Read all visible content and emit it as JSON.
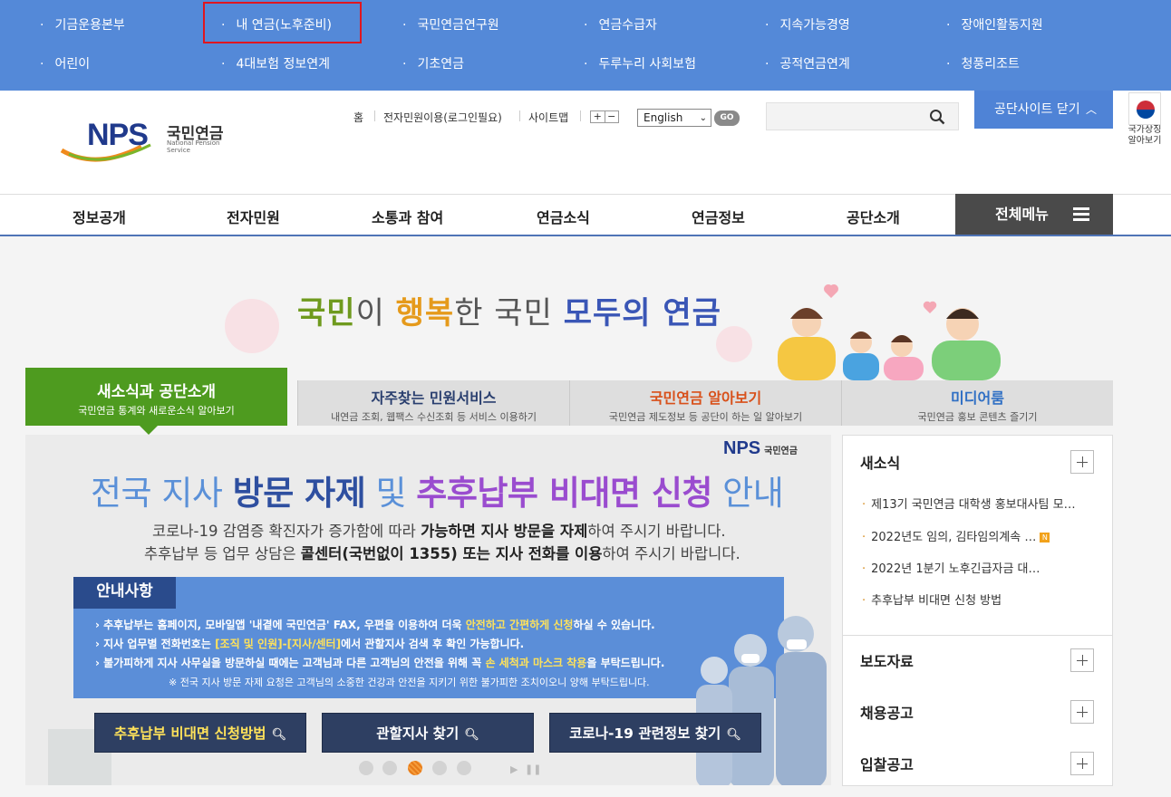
{
  "top_links": [
    {
      "label": "기금운용본부"
    },
    {
      "label": "내 연금(노후준비)"
    },
    {
      "label": "국민연금연구원"
    },
    {
      "label": "연금수급자"
    },
    {
      "label": "지속가능경영"
    },
    {
      "label": "장애인활동지원"
    },
    {
      "label": "어린이"
    },
    {
      "label": "4대보험 정보연계"
    },
    {
      "label": "기초연금"
    },
    {
      "label": "두루누리 사회보험"
    },
    {
      "label": "공적연금연계"
    },
    {
      "label": "청풍리조트"
    }
  ],
  "logo": {
    "mark": "NPS",
    "name": "국민연금",
    "english": "National Pension Service"
  },
  "util": {
    "home": "홈",
    "e_civil": "전자민원이용(로그인필요)",
    "sitemap": "사이트맵",
    "zoom_in": "+",
    "zoom_out": "−",
    "language": "English",
    "go": "GO"
  },
  "search": {
    "placeholder": ""
  },
  "close_site": "공단사이트 닫기",
  "national_symbol": {
    "line1": "국가상징",
    "line2": "알아보기"
  },
  "gnb": [
    {
      "label": "정보공개"
    },
    {
      "label": "전자민원"
    },
    {
      "label": "소통과 참여"
    },
    {
      "label": "연금소식"
    },
    {
      "label": "연금정보"
    },
    {
      "label": "공단소개"
    }
  ],
  "all_menu": "전체메뉴",
  "slogan": {
    "p1": "국민",
    "p2": "이 ",
    "p3": "행복",
    "p4": "한 국민 ",
    "p5": "모두의 연금"
  },
  "tabs": [
    {
      "title": "새소식과 공단소개",
      "sub": "국민연금 통계와 새로운소식 알아보기"
    },
    {
      "title": "자주찾는 민원서비스",
      "sub": "내연금 조회, 웹팩스 수신조회 등 서비스 이용하기"
    },
    {
      "title": "국민연금 알아보기",
      "sub": "국민연금 제도정보 등 공단이 하는 일 알아보기"
    },
    {
      "title": "미디어룸",
      "sub": "국민연금 홍보 콘텐츠 즐기기"
    }
  ],
  "banner": {
    "logo_mark": "NPS",
    "logo_name": "국민연금",
    "title": {
      "a": "전국 지사 ",
      "b": "방문 자제",
      "c": " 및 ",
      "d": "추후납부 비대면 신청",
      "e": " 안내"
    },
    "line1": {
      "a": "코로나-19 감염증 확진자가 증가함에 따라 ",
      "b": "가능하면 지사 방문을 자제",
      "c": "하여 주시기 바랍니다."
    },
    "line2": {
      "a": "추후납부 등 업무 상담은 ",
      "b": "콜센터(국번없이 1355) 또는 지사 전화를 이용",
      "c": "하여 주시기 바랍니다."
    },
    "notice_head": "안내사항",
    "notice": [
      {
        "a": "추후납부는 홈페이지, 모바일앱 '내곁에 국민연금' FAX, 우편을 이용하여 더욱 ",
        "b": "안전하고 간편하게 신청",
        "c": "하실 수 있습니다."
      },
      {
        "a": "지사 업무별 전화번호는 ",
        "b": "[조직 및 인원]-[지사/센터]",
        "c": "에서 관할지사 검색 후 확인 가능합니다."
      },
      {
        "a": "불가피하게 지사 사무실을 방문하실 때에는 고객님과 다른 고객님의 안전을 위해 꼭 ",
        "b": "손 세척과 마스크 착용",
        "c": "을 부탁드립니다."
      }
    ],
    "notice_sub": "※ 전국 지사 방문 자제 요청은 고객님의 소중한 건강과 안전을 지키기 위한 불가피한 조치이오니 양해 부탁드립니다.",
    "buttons": [
      {
        "label": "추후납부 비대면 신청방법"
      },
      {
        "label": "관할지사 찾기"
      },
      {
        "label": "코로나-19 관련정보 찾기"
      }
    ],
    "slide_current": 3,
    "slide_total": 5
  },
  "side": {
    "news_title": "새소식",
    "news": [
      {
        "text": "제13기 국민연금 대학생 홍보대사팀 모…",
        "is_new": false
      },
      {
        "text": "2022년도 임의, 김타임의계속 …",
        "is_new": true,
        "badge": "N"
      },
      {
        "text": "2022년 1분기 노후긴급자금 대…",
        "is_new": false
      },
      {
        "text": "추후납부 비대면 신청 방법",
        "is_new": false
      }
    ],
    "press": "보도자료",
    "jobs": "채용공고",
    "bids": "입찰공고"
  },
  "colors": {
    "top_bar": "#5489d8",
    "active_tab": "#4e9b1f",
    "brand_navy": "#203a8c",
    "highlight_box": "#e0161f"
  }
}
